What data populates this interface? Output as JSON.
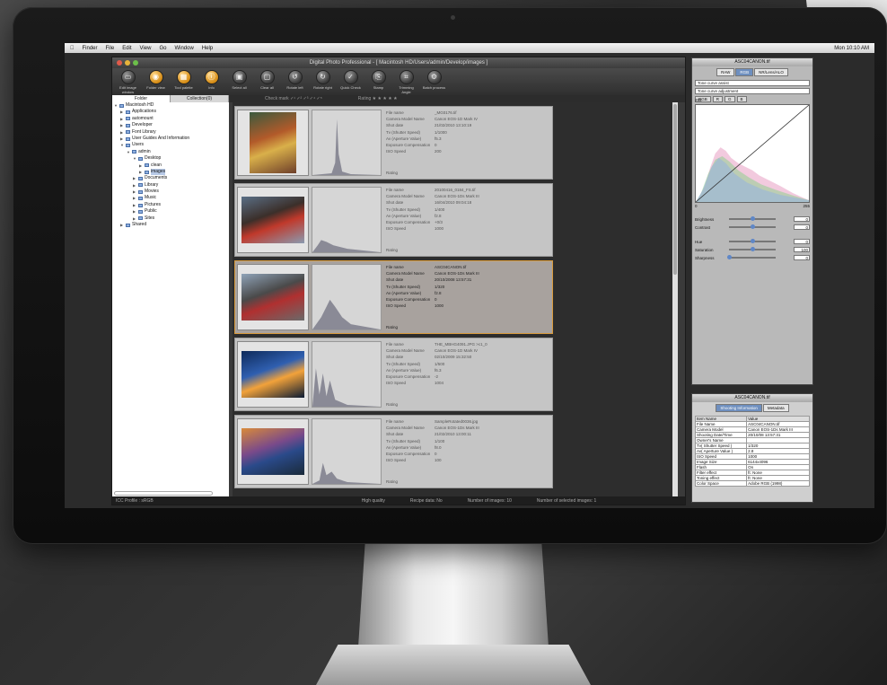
{
  "menubar": {
    "apple": "",
    "items": [
      "Finder",
      "File",
      "Edit",
      "View",
      "Go",
      "Window",
      "Help"
    ],
    "clock": "Mon 10:10 AM"
  },
  "window": {
    "title": "Digital Photo Professional - [ Macintosh HD/Users/admin/Develop/images ]"
  },
  "toolbar": [
    {
      "icon": "edit-image-window-icon",
      "label": "Edit image window"
    },
    {
      "icon": "folder-view-icon",
      "label": "Folder view"
    },
    {
      "icon": "tool-palette-icon",
      "label": "Tool palette"
    },
    {
      "icon": "info-icon",
      "label": "Info"
    },
    {
      "icon": "select-all-icon",
      "label": "Select all"
    },
    {
      "icon": "clear-all-icon",
      "label": "Clear all"
    },
    {
      "icon": "rotate-left-icon",
      "label": "Rotate left"
    },
    {
      "icon": "rotate-right-icon",
      "label": "Rotate right"
    },
    {
      "icon": "quick-check-icon",
      "label": "Quick Check"
    },
    {
      "icon": "stamp-icon",
      "label": "Stamp"
    },
    {
      "icon": "trimming-angle-icon",
      "label": "Trimming Angle"
    },
    {
      "icon": "batch-process-icon",
      "label": "Batch process"
    }
  ],
  "tabs": {
    "folder": "Folder",
    "collection": "Collection(0)"
  },
  "subbar": {
    "check_mark": "Check mark",
    "rating": "Rating"
  },
  "tree": [
    {
      "depth": 0,
      "expanded": true,
      "label": "Macintosh HD"
    },
    {
      "depth": 1,
      "expanded": false,
      "label": "Applications"
    },
    {
      "depth": 1,
      "expanded": false,
      "label": "automount"
    },
    {
      "depth": 1,
      "expanded": false,
      "label": "Developer"
    },
    {
      "depth": 1,
      "expanded": false,
      "label": "Font Library"
    },
    {
      "depth": 1,
      "expanded": false,
      "label": "User Guides And Information"
    },
    {
      "depth": 1,
      "expanded": true,
      "label": "Users"
    },
    {
      "depth": 2,
      "expanded": true,
      "label": "admin"
    },
    {
      "depth": 3,
      "expanded": true,
      "label": "Desktop"
    },
    {
      "depth": 4,
      "expanded": false,
      "label": "clean"
    },
    {
      "depth": 4,
      "expanded": false,
      "label": "images",
      "selected": true
    },
    {
      "depth": 3,
      "expanded": false,
      "label": "Documents"
    },
    {
      "depth": 3,
      "expanded": false,
      "label": "Library"
    },
    {
      "depth": 3,
      "expanded": false,
      "label": "Movies"
    },
    {
      "depth": 3,
      "expanded": false,
      "label": "Music"
    },
    {
      "depth": 3,
      "expanded": false,
      "label": "Pictures"
    },
    {
      "depth": 3,
      "expanded": false,
      "label": "Public"
    },
    {
      "depth": 3,
      "expanded": false,
      "label": "Sites"
    },
    {
      "depth": 1,
      "expanded": false,
      "label": "Shared"
    }
  ],
  "meta_keys": [
    "File name",
    "Camera Model Name",
    "Shot date",
    "Tv (Shutter Speed)",
    "Av (Aperture Value)",
    "Exposure Compensation",
    "ISO Speed"
  ],
  "rating_label": "Rating",
  "images": [
    {
      "values": [
        "_MG0176.tif",
        "Canon EOS-1D Mark IV",
        "21/02/2010 13:10:19",
        "1/1000",
        "f5.3",
        "0",
        "200"
      ],
      "selected": false,
      "photo": [
        "#3a5a3e",
        "#b25a2a",
        "#d9b04a",
        "#6e3f2a"
      ]
    },
    {
      "values": [
        "20100416_0184_FS.tif",
        "Canon EOS-1Ds Mark III",
        "16/04/2010 09:04:18",
        "1/400",
        "f2.8",
        "+0/3",
        "1000"
      ],
      "selected": false,
      "photo": [
        "#5a6f86",
        "#3b2f2a",
        "#c0392b",
        "#8a9bb0"
      ]
    },
    {
      "values": [
        "ASC04CANON.tif",
        "Canon EOS-1Ds Mark III",
        "20/10/2008 13:57:31",
        "1/320",
        "f2.8",
        "0",
        "1000"
      ],
      "selected": true,
      "photo": [
        "#8fa3b8",
        "#4a4a4a",
        "#b03030",
        "#6a6a6a"
      ]
    },
    {
      "values": [
        "THE_MBHG4091.JPG >c1_0",
        "Canon EOS-1D Mark IV",
        "02/10/2009 15:32:50",
        "1/500",
        "f6.3",
        "-2",
        "1004"
      ],
      "selected": false,
      "photo": [
        "#0e2a5a",
        "#2f5fb0",
        "#f2a23a",
        "#0a1a33"
      ]
    },
    {
      "values": [
        "SampleRotated0036.jpg",
        "Canon EOS-1Ds Mark III",
        "21/02/2010 13:00:11",
        "1/100",
        "f8.0",
        "0",
        "100"
      ],
      "selected": false,
      "photo": [
        "#d98a3a",
        "#7a4a8a",
        "#2a4a8a",
        "#1a2a3a"
      ]
    }
  ],
  "status": {
    "icc": "ICC Profile : sRGB",
    "quality": "High quality",
    "recipe": "Recipe data: No",
    "count": "Number of images: 10",
    "selected": "Number of selected images: 1"
  },
  "palette": {
    "title": "ASC04CANON.tif",
    "tabs": [
      "RAW",
      "RGB",
      "NR/Lens/ALO"
    ],
    "preset": "Tone curve assist",
    "adjust": "Tone curve adjustment",
    "channels": [
      "RGB",
      "R",
      "G",
      "B"
    ],
    "curve_top": "255",
    "curve_zero": "0",
    "curve_right": "255",
    "sliders": [
      {
        "label": "Brightness",
        "value": "0",
        "pos": 0.5
      },
      {
        "label": "Contrast",
        "value": "0",
        "pos": 0.5
      },
      {
        "label": "Hue",
        "value": "0",
        "pos": 0.5
      },
      {
        "label": "Saturation",
        "value": "100",
        "pos": 0.5
      },
      {
        "label": "Sharpness",
        "value": "0",
        "pos": 0.0
      }
    ]
  },
  "info": {
    "title": "ASC04CANON.tif",
    "tabs": [
      "Shooting Information",
      "Metadata"
    ],
    "headers": [
      "Item Name",
      "Value"
    ],
    "rows": [
      [
        "File Name",
        "ASC04CANON.tif"
      ],
      [
        "Camera Model",
        "Canon EOS-1Ds Mark III"
      ],
      [
        "Shooting Date/Time",
        "20/10/08 13:57:31"
      ],
      [
        "Owner's Name",
        ""
      ],
      [
        "Tv( Shutter Speed )",
        "1/320"
      ],
      [
        "Av( Aperture Value )",
        "2.8"
      ],
      [
        "ISO Speed",
        "1000"
      ],
      [
        "Image Size",
        "6144x4096"
      ],
      [
        "Flash",
        "On"
      ],
      [
        "Filter effect",
        "ft: None"
      ],
      [
        "Toning effect",
        "ft: None"
      ],
      [
        "Color Space",
        "Adobe RGB (1998)"
      ]
    ]
  }
}
